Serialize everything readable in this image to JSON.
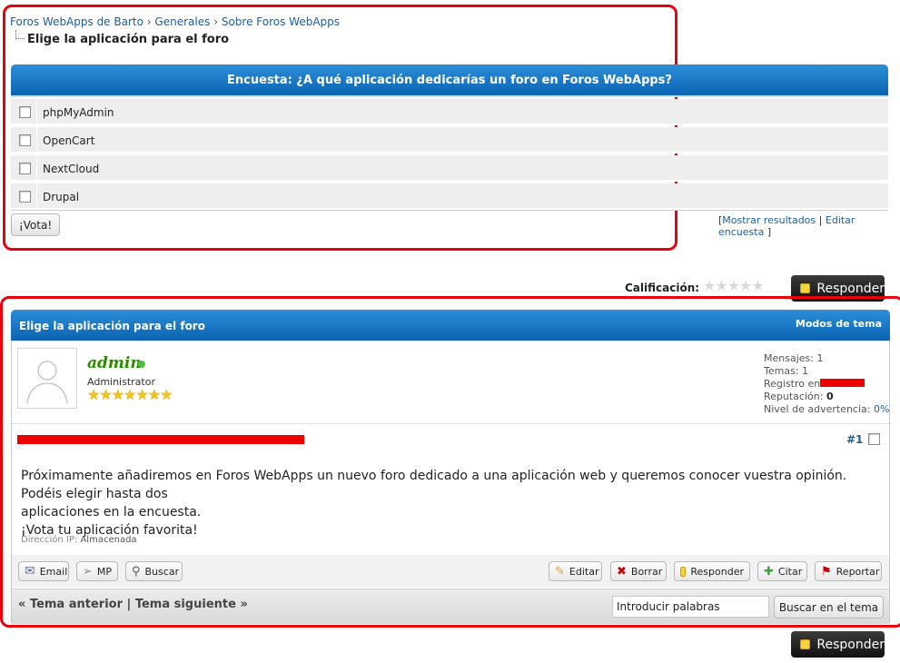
{
  "breadcrumb": {
    "items": [
      "Foros WebApps de Barto",
      "Generales",
      "Sobre Foros WebApps"
    ],
    "separator": "›",
    "current": "Elige la aplicación para el foro"
  },
  "poll": {
    "title": "Encuesta: ¿A qué aplicación dedicarías un foro en Foros WebApps?",
    "options": [
      "phpMyAdmin",
      "OpenCart",
      "NextCloud",
      "Drupal"
    ],
    "vote_label": "¡Vota!",
    "show_results_label": "Mostrar resultados",
    "edit_poll_label": "Editar encuesta",
    "bracket_open": "[",
    "bracket_close": "]",
    "link_sep": "|"
  },
  "rating": {
    "label": "Calificación:",
    "stars": 5,
    "value": 0
  },
  "reply_label": "Responder",
  "topic": {
    "title": "Elige la aplicación para el foro",
    "theme_modes_label": "Modos de tema"
  },
  "post": {
    "username": "admin",
    "role": "Administrator",
    "rank_stars": 7,
    "online": true,
    "stats": {
      "messages": "Mensajes: 1",
      "topics": "Temas: 1",
      "registered_label": "Registro en:",
      "reputation_label": "Reputación:",
      "reputation_value": "0",
      "warning_label": "Nivel de advertencia:",
      "warning_value": "0%"
    },
    "number": "#1",
    "body_line1": "Próximamente añadiremos en Foros WebApps un nuevo foro dedicado a una aplicación web y queremos conocer vuestra opinión. Podéis elegir hasta dos",
    "body_line2": "aplicaciones en la encuesta.",
    "body_line3": "¡Vota tu aplicación favorita!",
    "ip_label": "Dirección IP:",
    "ip_value": "Almacenada"
  },
  "post_actions_left": [
    "Email",
    "MP",
    "Buscar"
  ],
  "post_actions_right": [
    "Editar",
    "Borrar",
    "Responder",
    "Citar",
    "Reportar"
  ],
  "footer_nav": {
    "prev": "« Tema anterior",
    "sep": "|",
    "next": "Tema siguiente »",
    "search_value": "Introducir palabras",
    "search_button": "Buscar en el tema"
  },
  "colors": {
    "highlight_frame": "#e8000b",
    "header_blue": "#0b63b3",
    "username_green": "#2e8b00",
    "link_blue": "#1a5f9e"
  }
}
